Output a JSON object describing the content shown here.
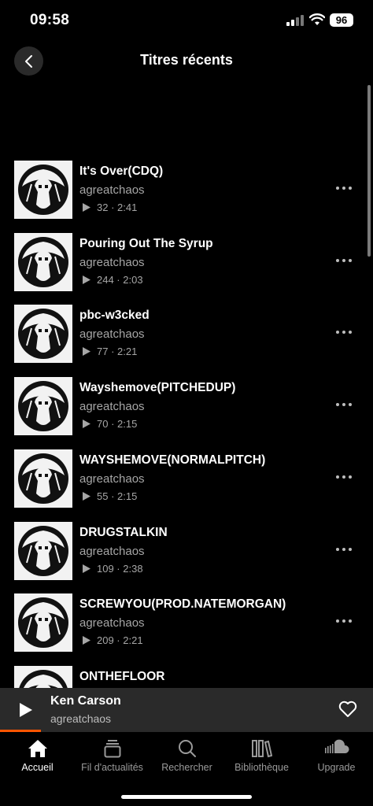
{
  "status_bar": {
    "time": "09:58",
    "battery": "96"
  },
  "header": {
    "title": "Titres récents"
  },
  "tracks": [
    {
      "title": "It's Over(CDQ)",
      "artist": "agreatchaos",
      "plays": "32",
      "duration": "2:41"
    },
    {
      "title": "Pouring Out The Syrup",
      "artist": "agreatchaos",
      "plays": "244",
      "duration": "2:03"
    },
    {
      "title": "pbc-w3cked",
      "artist": "agreatchaos",
      "plays": "77",
      "duration": "2:21"
    },
    {
      "title": "Wayshemove(PITCHEDUP)",
      "artist": "agreatchaos",
      "plays": "70",
      "duration": "2:15"
    },
    {
      "title": "WAYSHEMOVE(NORMALPITCH)",
      "artist": "agreatchaos",
      "plays": "55",
      "duration": "2:15"
    },
    {
      "title": "DRUGSTALKIN",
      "artist": "agreatchaos",
      "plays": "109",
      "duration": "2:38"
    },
    {
      "title": "SCREWYOU(PROD.NATEMORGAN)",
      "artist": "agreatchaos",
      "plays": "209",
      "duration": "2:21"
    },
    {
      "title": "ONTHEFLOOR",
      "artist": "",
      "plays": "",
      "duration": ""
    }
  ],
  "mini_player": {
    "title": "Ken Carson",
    "artist": "agreatchaos",
    "progress_fraction": 0.11
  },
  "tabs": [
    {
      "label": "Accueil",
      "icon": "home-icon",
      "active": true
    },
    {
      "label": "Fil d'actualités",
      "icon": "feed-icon",
      "active": false
    },
    {
      "label": "Rechercher",
      "icon": "search-icon",
      "active": false
    },
    {
      "label": "Bibliothèque",
      "icon": "library-icon",
      "active": false
    },
    {
      "label": "Upgrade",
      "icon": "soundcloud-icon",
      "active": false
    }
  ],
  "colors": {
    "accent": "#ff5500",
    "background": "#000000",
    "secondary_text": "#a6a6a6",
    "mini_player_bg": "#2a2a2a"
  }
}
